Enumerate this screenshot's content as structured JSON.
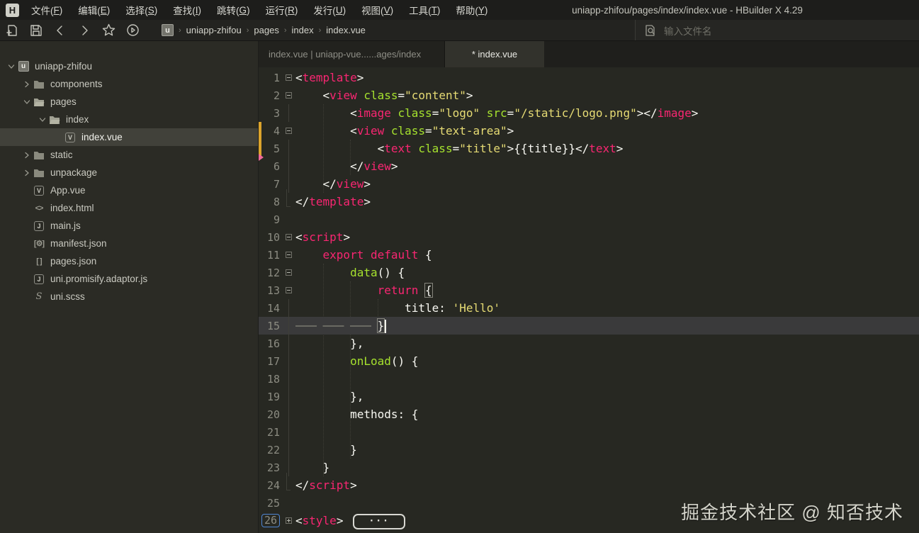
{
  "menubar": {
    "logo_letter": "H",
    "items": [
      {
        "name": "文件",
        "key": "F"
      },
      {
        "name": "编辑",
        "key": "E"
      },
      {
        "name": "选择",
        "key": "S"
      },
      {
        "name": "查找",
        "key": "I"
      },
      {
        "name": "跳转",
        "key": "G"
      },
      {
        "name": "运行",
        "key": "R"
      },
      {
        "name": "发行",
        "key": "U"
      },
      {
        "name": "视图",
        "key": "V"
      },
      {
        "name": "工具",
        "key": "T"
      },
      {
        "name": "帮助",
        "key": "Y"
      }
    ],
    "window_title": "uniapp-zhifou/pages/index/index.vue - HBuilder X 4.29"
  },
  "toolbar": {
    "icons": [
      "new-file",
      "save",
      "back",
      "forward",
      "star",
      "run"
    ],
    "breadcrumb": {
      "logo_letter": "u",
      "items": [
        "uniapp-zhifou",
        "pages",
        "index",
        "index.vue"
      ],
      "separator": "›"
    },
    "search": {
      "placeholder": "输入文件名"
    }
  },
  "sidebar": {
    "tree": [
      {
        "label": "uniapp-zhifou",
        "level": 0,
        "chev": "down",
        "icon": "uniapp",
        "selected": false
      },
      {
        "label": "components",
        "level": 1,
        "chev": "right",
        "icon": "folder",
        "selected": false
      },
      {
        "label": "pages",
        "level": 1,
        "chev": "down",
        "icon": "folder-open",
        "selected": false
      },
      {
        "label": "index",
        "level": 2,
        "chev": "down",
        "icon": "folder-open",
        "selected": false
      },
      {
        "label": "index.vue",
        "level": 3,
        "chev": "none",
        "icon": "vue",
        "selected": true
      },
      {
        "label": "static",
        "level": 1,
        "chev": "right",
        "icon": "folder",
        "selected": false
      },
      {
        "label": "unpackage",
        "level": 1,
        "chev": "right",
        "icon": "folder",
        "selected": false
      },
      {
        "label": "App.vue",
        "level": 1,
        "chev": "none",
        "icon": "vue",
        "selected": false
      },
      {
        "label": "index.html",
        "level": 1,
        "chev": "none",
        "icon": "html",
        "selected": false
      },
      {
        "label": "main.js",
        "level": 1,
        "chev": "none",
        "icon": "js",
        "selected": false
      },
      {
        "label": "manifest.json",
        "level": 1,
        "chev": "none",
        "icon": "json-gear",
        "selected": false
      },
      {
        "label": "pages.json",
        "level": 1,
        "chev": "none",
        "icon": "json-brackets",
        "selected": false
      },
      {
        "label": "uni.promisify.adaptor.js",
        "level": 1,
        "chev": "none",
        "icon": "js",
        "selected": false
      },
      {
        "label": "uni.scss",
        "level": 1,
        "chev": "none",
        "icon": "scss",
        "selected": false
      }
    ]
  },
  "editor": {
    "tabs": [
      {
        "label": "index.vue | uniapp-vue......ages/index",
        "active": false
      },
      {
        "label": "* index.vue",
        "active": true
      }
    ],
    "syntax_colors": {
      "w": "#f8f8f2",
      "p": "#f92672",
      "g": "#a6e22e",
      "y": "#e6db74",
      "dim": "#75715e"
    },
    "modified_marker_color": "#dca42c",
    "lines": [
      {
        "num": 1,
        "fold": "minus",
        "ind": 0,
        "tokens": [
          {
            "t": "<",
            "c": "w"
          },
          {
            "t": "template",
            "c": "p"
          },
          {
            "t": ">",
            "c": "w"
          }
        ]
      },
      {
        "num": 2,
        "fold": "minus",
        "ind": 1,
        "tokens": [
          {
            "t": "<",
            "c": "w"
          },
          {
            "t": "view",
            "c": "p"
          },
          {
            "t": " ",
            "c": "w"
          },
          {
            "t": "class",
            "c": "g"
          },
          {
            "t": "=",
            "c": "w"
          },
          {
            "t": "\"content\"",
            "c": "y"
          },
          {
            "t": ">",
            "c": "w"
          }
        ]
      },
      {
        "num": 3,
        "fold": "vline",
        "ind": 2,
        "tokens": [
          {
            "t": "<",
            "c": "w"
          },
          {
            "t": "image",
            "c": "p"
          },
          {
            "t": " ",
            "c": "w"
          },
          {
            "t": "class",
            "c": "g"
          },
          {
            "t": "=",
            "c": "w"
          },
          {
            "t": "\"logo\"",
            "c": "y"
          },
          {
            "t": " ",
            "c": "w"
          },
          {
            "t": "src",
            "c": "g"
          },
          {
            "t": "=",
            "c": "w"
          },
          {
            "t": "\"/static/logo.png\"",
            "c": "y"
          },
          {
            "t": "></",
            "c": "w"
          },
          {
            "t": "image",
            "c": "p"
          },
          {
            "t": ">",
            "c": "w"
          }
        ]
      },
      {
        "num": 4,
        "fold": "minus",
        "ind": 2,
        "tokens": [
          {
            "t": "<",
            "c": "w"
          },
          {
            "t": "view",
            "c": "p"
          },
          {
            "t": " ",
            "c": "w"
          },
          {
            "t": "class",
            "c": "g"
          },
          {
            "t": "=",
            "c": "w"
          },
          {
            "t": "\"text-area\"",
            "c": "y"
          },
          {
            "t": ">",
            "c": "w"
          }
        ]
      },
      {
        "num": 5,
        "fold": "vline",
        "ind": 3,
        "tokens": [
          {
            "t": "<",
            "c": "w"
          },
          {
            "t": "text",
            "c": "p"
          },
          {
            "t": " ",
            "c": "w"
          },
          {
            "t": "class",
            "c": "g"
          },
          {
            "t": "=",
            "c": "w"
          },
          {
            "t": "\"title\"",
            "c": "y"
          },
          {
            "t": ">",
            "c": "w"
          },
          {
            "t": "{{title}}",
            "c": "w"
          },
          {
            "t": "</",
            "c": "w"
          },
          {
            "t": "text",
            "c": "p"
          },
          {
            "t": ">",
            "c": "w"
          }
        ]
      },
      {
        "num": 6,
        "fold": "vline",
        "ind": 2,
        "tokens": [
          {
            "t": "</",
            "c": "w"
          },
          {
            "t": "view",
            "c": "p"
          },
          {
            "t": ">",
            "c": "w"
          }
        ]
      },
      {
        "num": 7,
        "fold": "vline",
        "ind": 1,
        "tokens": [
          {
            "t": "</",
            "c": "w"
          },
          {
            "t": "view",
            "c": "p"
          },
          {
            "t": ">",
            "c": "w"
          }
        ]
      },
      {
        "num": 8,
        "fold": "corner",
        "ind": 0,
        "tokens": [
          {
            "t": "</",
            "c": "w"
          },
          {
            "t": "template",
            "c": "p"
          },
          {
            "t": ">",
            "c": "w"
          }
        ]
      },
      {
        "num": 9,
        "fold": "none",
        "ind": 0,
        "tokens": []
      },
      {
        "num": 10,
        "fold": "minus",
        "ind": 0,
        "tokens": [
          {
            "t": "<",
            "c": "w"
          },
          {
            "t": "script",
            "c": "p"
          },
          {
            "t": ">",
            "c": "w"
          }
        ]
      },
      {
        "num": 11,
        "fold": "minus",
        "ind": 1,
        "tokens": [
          {
            "t": "export",
            "c": "p"
          },
          {
            "t": " ",
            "c": "w"
          },
          {
            "t": "default",
            "c": "p"
          },
          {
            "t": " {",
            "c": "w"
          }
        ]
      },
      {
        "num": 12,
        "fold": "minus",
        "ind": 2,
        "tokens": [
          {
            "t": "data",
            "c": "g"
          },
          {
            "t": "() {",
            "c": "w"
          }
        ]
      },
      {
        "num": 13,
        "fold": "minus",
        "ind": 3,
        "tokens": [
          {
            "t": "return",
            "c": "p"
          },
          {
            "t": " ",
            "c": "w"
          },
          {
            "t": "{",
            "c": "w",
            "box": true
          }
        ]
      },
      {
        "num": 14,
        "fold": "vline",
        "ind": 4,
        "tokens": [
          {
            "t": "title",
            "c": "w"
          },
          {
            "t": ": ",
            "c": "w"
          },
          {
            "t": "'Hello'",
            "c": "y"
          }
        ]
      },
      {
        "num": 15,
        "fold": "vline",
        "ind": 0,
        "current": true,
        "tokens": [
          {
            "dash": 3
          },
          {
            "t": "}",
            "c": "w",
            "box": true
          },
          {
            "cursor": true
          }
        ]
      },
      {
        "num": 16,
        "fold": "vline",
        "ind": 2,
        "tokens": [
          {
            "t": "},",
            "c": "w"
          }
        ]
      },
      {
        "num": 17,
        "fold": "vline",
        "ind": 2,
        "tokens": [
          {
            "t": "onLoad",
            "c": "g"
          },
          {
            "t": "() {",
            "c": "w"
          }
        ]
      },
      {
        "num": 18,
        "fold": "vline",
        "ind": 0,
        "tokens": []
      },
      {
        "num": 19,
        "fold": "vline",
        "ind": 2,
        "tokens": [
          {
            "t": "},",
            "c": "w"
          }
        ]
      },
      {
        "num": 20,
        "fold": "vline",
        "ind": 2,
        "tokens": [
          {
            "t": "methods: {",
            "c": "w"
          }
        ]
      },
      {
        "num": 21,
        "fold": "vline",
        "ind": 0,
        "tokens": []
      },
      {
        "num": 22,
        "fold": "vline",
        "ind": 2,
        "tokens": [
          {
            "t": "}",
            "c": "w"
          }
        ]
      },
      {
        "num": 23,
        "fold": "vline",
        "ind": 1,
        "tokens": [
          {
            "t": "}",
            "c": "w"
          }
        ]
      },
      {
        "num": 24,
        "fold": "corner",
        "ind": 0,
        "tokens": [
          {
            "t": "</",
            "c": "w"
          },
          {
            "t": "script",
            "c": "p"
          },
          {
            "t": ">",
            "c": "w"
          }
        ]
      },
      {
        "num": 25,
        "fold": "none",
        "ind": 0,
        "tokens": []
      },
      {
        "num": 26,
        "fold": "plus",
        "ind": 0,
        "numBox": true,
        "tokens": [
          {
            "t": "<",
            "c": "w"
          },
          {
            "t": "style",
            "c": "p"
          },
          {
            "t": ">",
            "c": "w"
          },
          {
            "pill": "···"
          }
        ]
      }
    ]
  },
  "watermark": "掘金技术社区 @ 知否技术"
}
